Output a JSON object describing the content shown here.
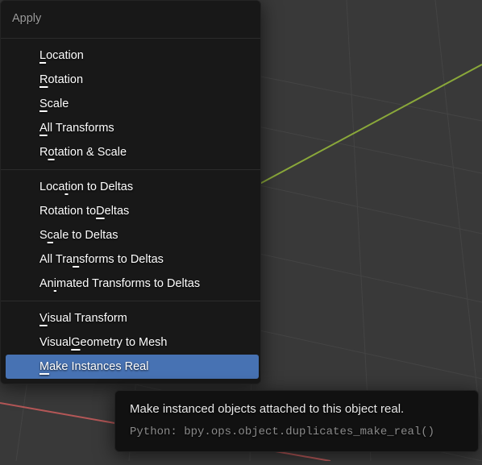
{
  "menu": {
    "title": "Apply",
    "sections": [
      {
        "items": [
          {
            "label": "Location",
            "u": 0
          },
          {
            "label": "Rotation",
            "u": 0
          },
          {
            "label": "Scale",
            "u": 0
          },
          {
            "label": "All Transforms",
            "u": 0
          },
          {
            "label": "Rotation & Scale",
            "u": 1
          }
        ]
      },
      {
        "items": [
          {
            "label": "Location to Deltas",
            "u": 4
          },
          {
            "label": "Rotation to Deltas",
            "u": 12
          },
          {
            "label": "Scale to Deltas",
            "u": 1
          },
          {
            "label": "All Transforms to Deltas",
            "u": 7
          },
          {
            "label": "Animated Transforms to Deltas",
            "u": 2
          }
        ]
      },
      {
        "items": [
          {
            "label": "Visual Transform",
            "u": 0
          },
          {
            "label": "Visual Geometry to Mesh",
            "u": 7
          },
          {
            "label": "Make Instances Real",
            "u": 0,
            "highlighted": true
          }
        ]
      }
    ]
  },
  "tooltip": {
    "title": "Make instanced objects attached to this object real.",
    "python_label": "Python: ",
    "python_call": "bpy.ops.object.duplicates_make_real()"
  },
  "colors": {
    "grid_minor": "#444444",
    "grid_major": "#4a4a4a",
    "axis_x": "#b45757",
    "axis_y": "#7aa23a",
    "highlight": "#4772b3"
  }
}
